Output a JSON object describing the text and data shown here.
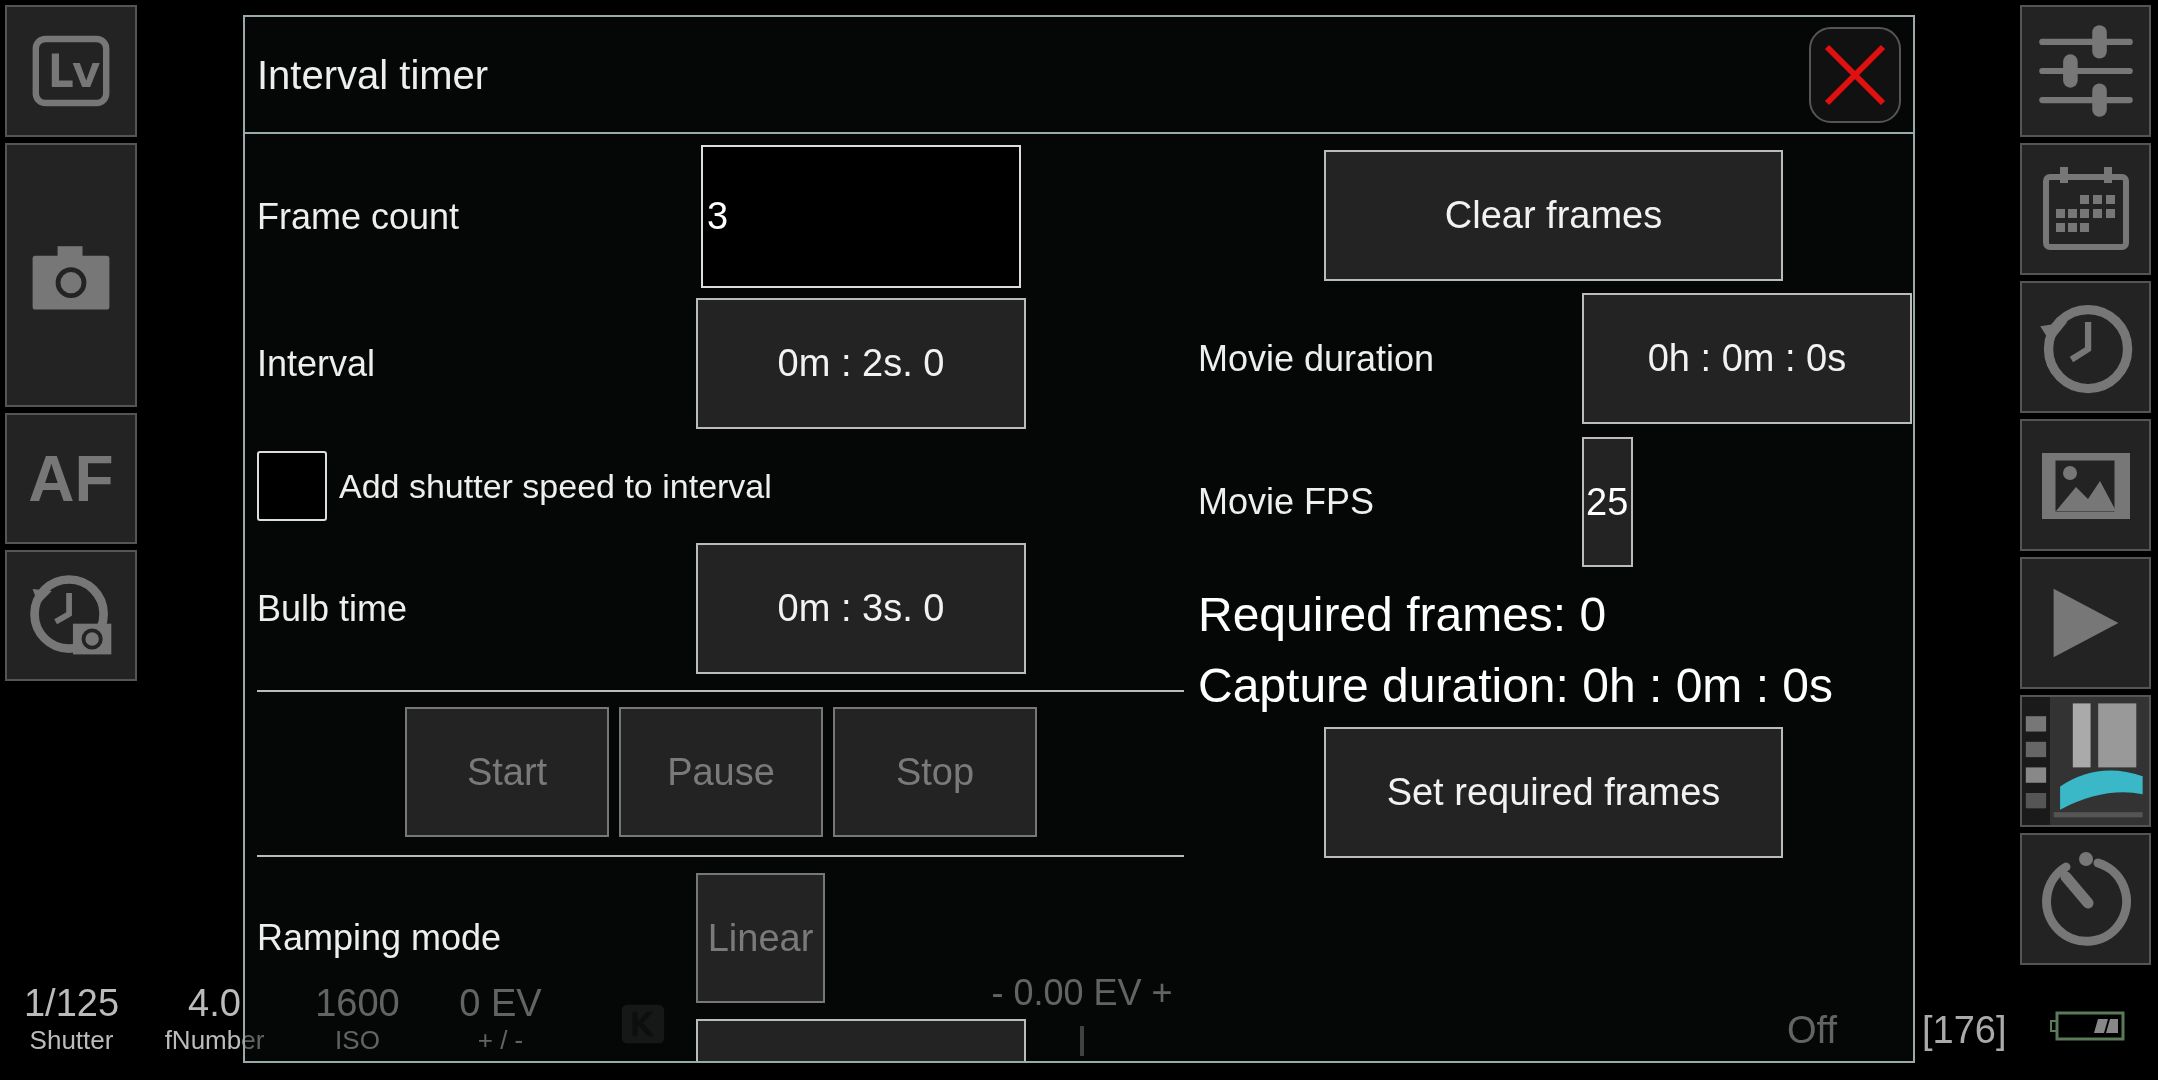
{
  "sidebar": {
    "autofocus_label": "AF"
  },
  "dialog": {
    "title": "Interval timer",
    "frame_count": {
      "label": "Frame count",
      "value": "3"
    },
    "interval": {
      "label": "Interval",
      "value": "0m : 2s. 0"
    },
    "add_shutter": {
      "label": "Add shutter speed to interval",
      "checked": false
    },
    "bulb_time": {
      "label": "Bulb time",
      "value": "0m : 3s. 0"
    },
    "controls": [
      {
        "label": "Start",
        "disabled": true
      },
      {
        "label": "Pause",
        "disabled": true
      },
      {
        "label": "Stop",
        "disabled": true
      }
    ],
    "ramping_mode": {
      "label": "Ramping mode",
      "value": "Linear",
      "disabled": true
    },
    "clear_frames": "Clear frames",
    "movie_duration": {
      "label": "Movie duration",
      "value": "0h : 0m : 0s"
    },
    "movie_fps": {
      "label": "Movie FPS",
      "value": "25"
    },
    "required_frames": "Required frames: 0",
    "capture_duration": "Capture duration: 0h : 0m : 0s",
    "set_required_frames": "Set required frames"
  },
  "status_bar": {
    "exposure": [
      {
        "value": "1/125",
        "label": "Shutter"
      },
      {
        "value": "4.0",
        "label": "fNumber"
      },
      {
        "value": "1600",
        "label": "ISO"
      },
      {
        "value": "0 EV",
        "label": "+ / -"
      }
    ],
    "ev_compensation": "- 0.00 EV +",
    "mode": "Off",
    "shots_remaining": "[176]"
  }
}
